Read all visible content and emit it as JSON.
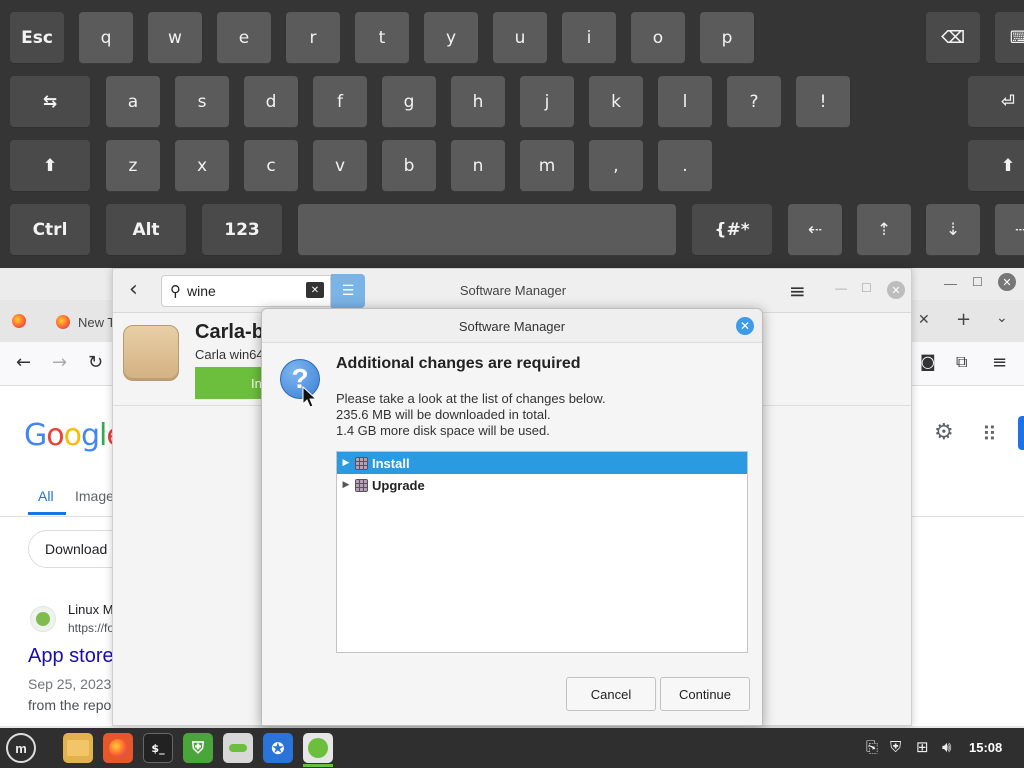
{
  "keyboard": {
    "row1": [
      "Esc",
      "q",
      "w",
      "e",
      "r",
      "t",
      "y",
      "u",
      "i",
      "o",
      "p"
    ],
    "row2": [
      "a",
      "s",
      "d",
      "f",
      "g",
      "h",
      "j",
      "k",
      "l",
      "?",
      "!"
    ],
    "row3": [
      "z",
      "x",
      "c",
      "v",
      "b",
      "n",
      "m",
      ",",
      "."
    ],
    "row4": [
      "Ctrl",
      "Alt",
      "123",
      "{#*"
    ],
    "icons": {
      "backspace": "⌫",
      "tab": "⇆",
      "enter": "⏎",
      "shift": "⬆",
      "left": "⇠",
      "up": "⇡",
      "down": "⇣",
      "right": "⇢"
    }
  },
  "browser": {
    "tab_label": "New T",
    "google_logo": [
      "G",
      "o",
      "o",
      "g",
      "l",
      "e"
    ],
    "search_tabs": [
      "All",
      "Image"
    ],
    "chip_label": "Download",
    "result": {
      "site": "Linux M",
      "url": "https://fo",
      "title": "App store",
      "date": "Sep 25, 2023",
      "snippet": "from the repo"
    }
  },
  "software_manager": {
    "window_title": "Software Manager",
    "search_value": "wine",
    "app_name": "Carla-b",
    "app_subtitle": "Carla win64",
    "install_label": "In"
  },
  "dialog": {
    "title": "Software Manager",
    "heading": "Additional changes are required",
    "lines": [
      "Please take a look at the list of changes below.",
      "235.6 MB will be downloaded in total.",
      "1.4 GB more disk space will be used."
    ],
    "tree": [
      {
        "label": "Install",
        "selected": true
      },
      {
        "label": "Upgrade",
        "selected": false
      }
    ],
    "cancel_label": "Cancel",
    "continue_label": "Continue"
  },
  "taskbar": {
    "clock": "15:08",
    "terminal_glyph": "$_"
  },
  "colors": {
    "accent": "#2a9be0",
    "install_green": "#6cbf3c",
    "keyboard_bg": "#353535",
    "key_bg": "#5b5b5b"
  }
}
